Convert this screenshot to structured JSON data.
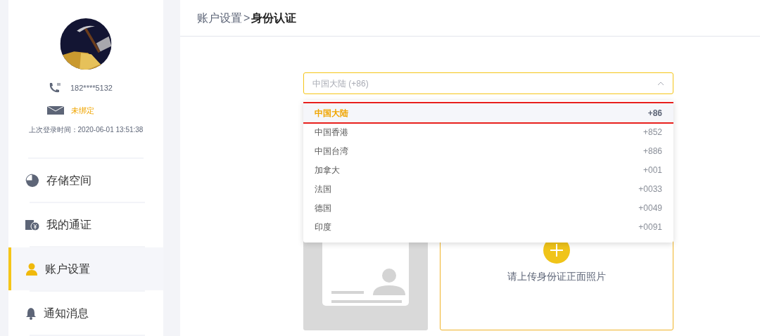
{
  "profile": {
    "phone": "182****5132",
    "email": "未绑定",
    "last_login": "上次登录时间：2020-06-01 13:51:38"
  },
  "nav": [
    {
      "kind": "storage",
      "label": "存储空间",
      "selected": false
    },
    {
      "kind": "token",
      "label": "我的通证",
      "selected": false
    },
    {
      "kind": "account",
      "label": "账户设置",
      "selected": true
    },
    {
      "kind": "bell",
      "label": "通知消息",
      "selected": false
    }
  ],
  "breadcrumb": {
    "parent": "账户设置",
    "separator": ">",
    "current": "身份认证"
  },
  "country_select": {
    "value": "中国大陆 (+86)",
    "expanded": true
  },
  "countries": [
    {
      "name": "中国大陆",
      "code": "+86",
      "selected": true,
      "outlined": true
    },
    {
      "name": "中国香港",
      "code": "+852",
      "selected": false,
      "outlined": false
    },
    {
      "name": "中国台湾",
      "code": "+886",
      "selected": false,
      "outlined": false
    },
    {
      "name": "加拿大",
      "code": "+001",
      "selected": false,
      "outlined": false
    },
    {
      "name": "法国",
      "code": "+0033",
      "selected": false,
      "outlined": false
    },
    {
      "name": "德国",
      "code": "+0049",
      "selected": false,
      "outlined": false
    },
    {
      "name": "印度",
      "code": "+0091",
      "selected": false,
      "outlined": false
    }
  ],
  "upload": {
    "label": "请上传身份证正面照片"
  }
}
